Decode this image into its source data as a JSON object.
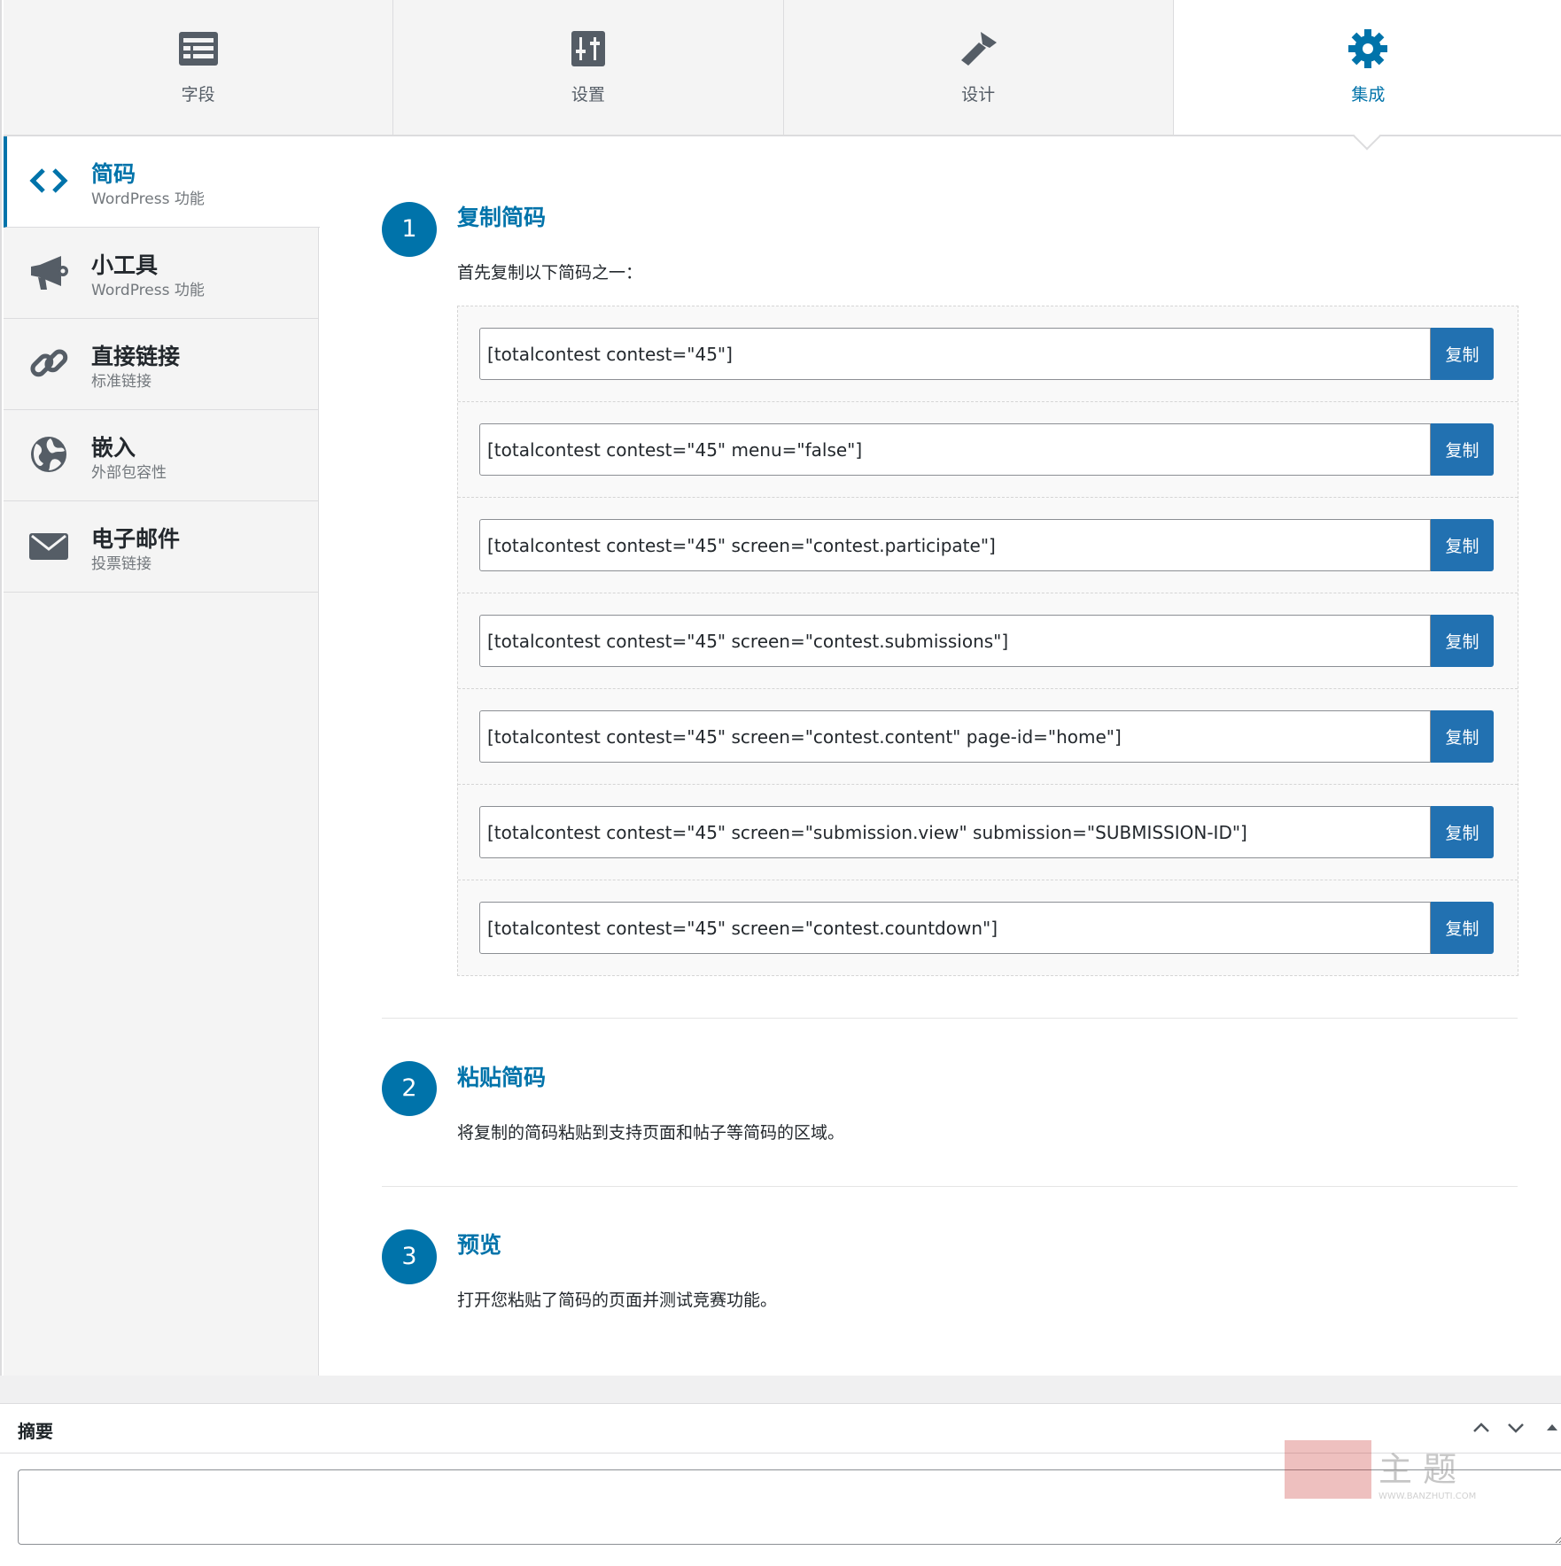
{
  "tabs": [
    {
      "label": "字段",
      "icon": "fields-icon"
    },
    {
      "label": "设置",
      "icon": "settings-sliders-icon"
    },
    {
      "label": "设计",
      "icon": "design-brush-icon"
    },
    {
      "label": "集成",
      "icon": "integration-gear-icon",
      "active": true
    }
  ],
  "sidebar": {
    "items": [
      {
        "title": "简码",
        "subtitle": "WordPress 功能",
        "icon": "code-brackets-icon",
        "active": true
      },
      {
        "title": "小工具",
        "subtitle": "WordPress 功能",
        "icon": "megaphone-icon"
      },
      {
        "title": "直接链接",
        "subtitle": "标准链接",
        "icon": "link-icon"
      },
      {
        "title": "嵌入",
        "subtitle": "外部包容性",
        "icon": "globe-icon"
      },
      {
        "title": "电子邮件",
        "subtitle": "投票链接",
        "icon": "envelope-icon"
      }
    ]
  },
  "steps": [
    {
      "number": "1",
      "title": "复制简码",
      "description": "首先复制以下简码之一："
    },
    {
      "number": "2",
      "title": "粘贴简码",
      "description": "将复制的简码粘贴到支持页面和帖子等简码的区域。"
    },
    {
      "number": "3",
      "title": "预览",
      "description": "打开您粘贴了简码的页面并测试竞赛功能。"
    }
  ],
  "shortcodes": [
    "[totalcontest contest=\"45\"]",
    "[totalcontest contest=\"45\" menu=\"false\"]",
    "[totalcontest contest=\"45\" screen=\"contest.participate\"]",
    "[totalcontest contest=\"45\" screen=\"contest.submissions\"]",
    "[totalcontest contest=\"45\" screen=\"contest.content\" page-id=\"home\"]",
    "[totalcontest contest=\"45\" screen=\"submission.view\" submission=\"SUBMISSION-ID\"]",
    "[totalcontest contest=\"45\" screen=\"contest.countdown\"]"
  ],
  "copy_label": "复制",
  "excerpt": {
    "title": "摘要",
    "value": ""
  },
  "watermark": {
    "main": "搬主题",
    "url": "WWW.BANZHUTI.COM"
  },
  "colors": {
    "accent": "#0073aa",
    "button": "#2271b1"
  }
}
